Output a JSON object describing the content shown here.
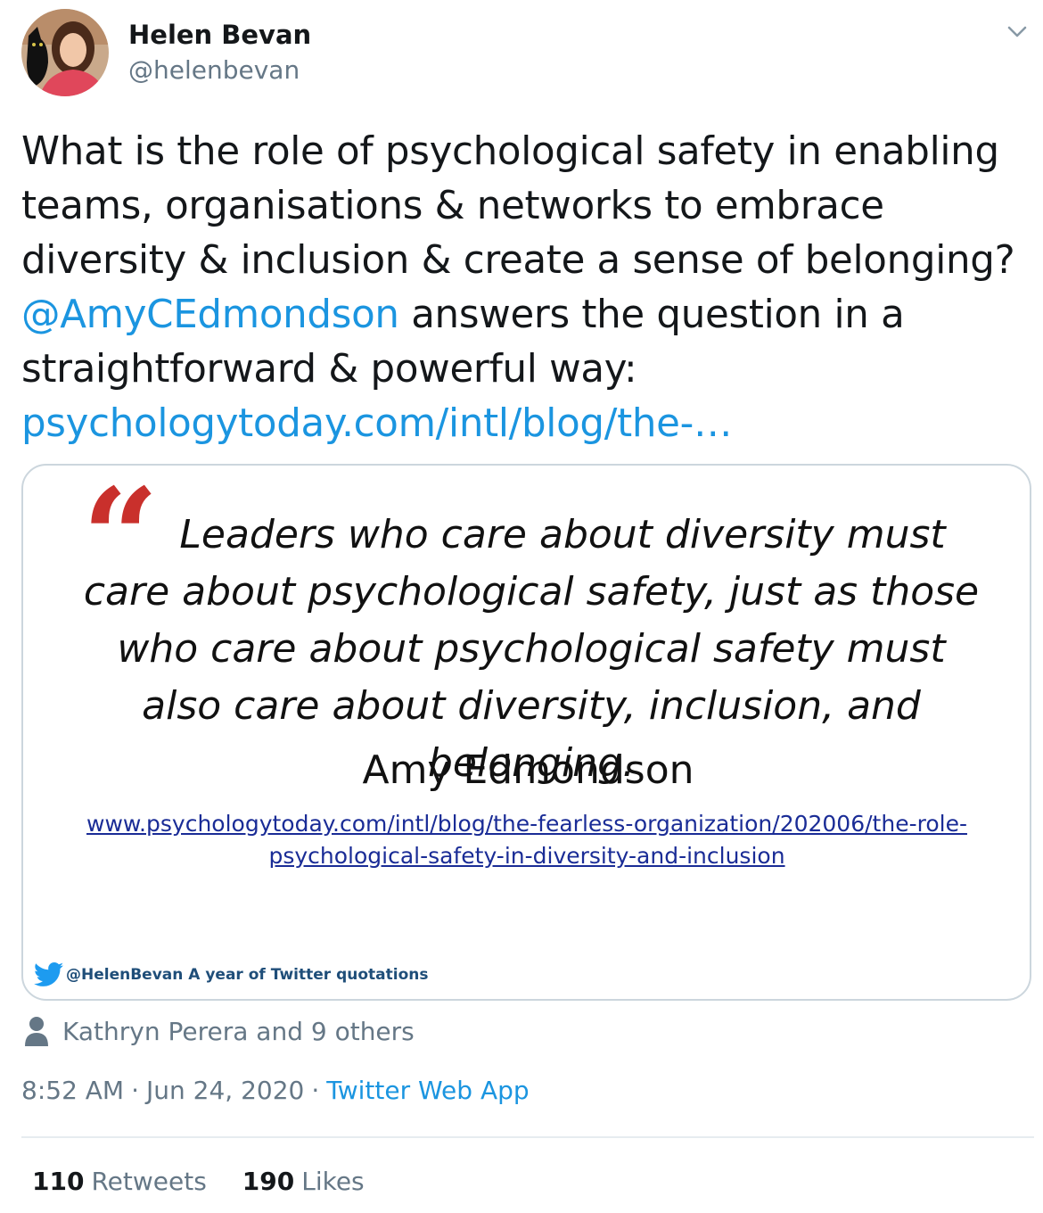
{
  "author": {
    "display_name": "Helen Bevan",
    "handle": "@helenbevan"
  },
  "tweet": {
    "text_part1": "What is the role of psychological safety in enabling teams, organisations & networks to embrace diversity & inclusion & create a sense of belonging? ",
    "mention": "@AmyCEdmondson",
    "text_part2": " answers the question in a straightforward & powerful way: ",
    "link": "psychologytoday.com/intl/blog/the-…"
  },
  "media": {
    "quote": "Leaders who care about diversity must care about psychological safety, just as those who care about psychological safety must also care about diversity, inclusion, and belonging.",
    "quote_author": "Amy Edmondson",
    "quote_url": "www.psychologytoday.com/intl/blog/the-fearless-organization/202006/the-role-psychological-safety-in-diversity-and-inclusion",
    "watermark": "@HelenBevan A year of Twitter quotations"
  },
  "liked_by": "Kathryn Perera and 9 others",
  "meta": {
    "time": "8:52 AM",
    "date": "Jun 24, 2020",
    "source": "Twitter Web App"
  },
  "stats": {
    "retweets_count": "110",
    "retweets_label": "Retweets",
    "likes_count": "190",
    "likes_label": "Likes"
  },
  "colors": {
    "link": "#1b95e0",
    "secondary_text": "#657786",
    "quote_mark": "#c9302c"
  }
}
